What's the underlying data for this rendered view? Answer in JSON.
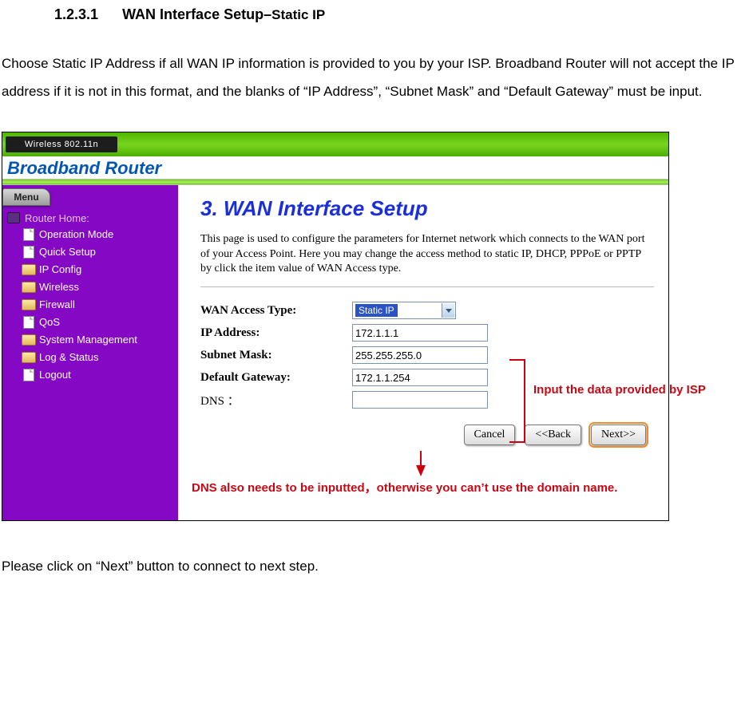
{
  "heading": {
    "number": "1.2.3.1",
    "title_main": "WAN Interface Setup–",
    "title_sub": "Static IP"
  },
  "intro": "Choose Static IP Address if all WAN IP information is provided to you by your ISP. Broadband Router will not accept the IP address if it is not in this format, and the blanks of “IP Address”, “Subnet Mask” and “Default Gateway” must be input.",
  "closing": "Please click on “Next” button to connect to next step.",
  "router": {
    "wireless_label": "Wireless 802.11n",
    "brand": "Broadband Router",
    "menu_tab": "Menu",
    "menu_root": "Router Home:",
    "menu_items": [
      {
        "label": "Operation Mode",
        "type": "page"
      },
      {
        "label": "Quick Setup",
        "type": "page"
      },
      {
        "label": "IP Config",
        "type": "folder"
      },
      {
        "label": "Wireless",
        "type": "folder"
      },
      {
        "label": "Firewall",
        "type": "folder"
      },
      {
        "label": "QoS",
        "type": "page"
      },
      {
        "label": "System Management",
        "type": "folder"
      },
      {
        "label": "Log & Status",
        "type": "folder"
      },
      {
        "label": "Logout",
        "type": "page"
      }
    ],
    "section_title": "3. WAN Interface Setup",
    "section_desc": "This page is used to configure the parameters for Internet network which connects to the WAN port of your Access Point. Here you may change the access method to static IP, DHCP, PPPoE or PPTP by click the item value of WAN Access type.",
    "fields": {
      "wan_access_type": {
        "label": "WAN Access Type:",
        "value": "Static IP"
      },
      "ip_address": {
        "label": "IP Address:",
        "value": "172.1.1.1"
      },
      "subnet_mask": {
        "label": "Subnet Mask:",
        "value": "255.255.255.0"
      },
      "default_gateway": {
        "label": "Default Gateway:",
        "value": "172.1.1.254"
      },
      "dns": {
        "label": "DNS ：",
        "value": ""
      }
    },
    "buttons": {
      "cancel": "Cancel",
      "back": "<<Back",
      "next": "Next>>"
    }
  },
  "annotations": {
    "isp_note": "Input the data provided by ISP",
    "dns_note": "DNS also needs to be inputted，otherwise you can’t use the domain name."
  }
}
